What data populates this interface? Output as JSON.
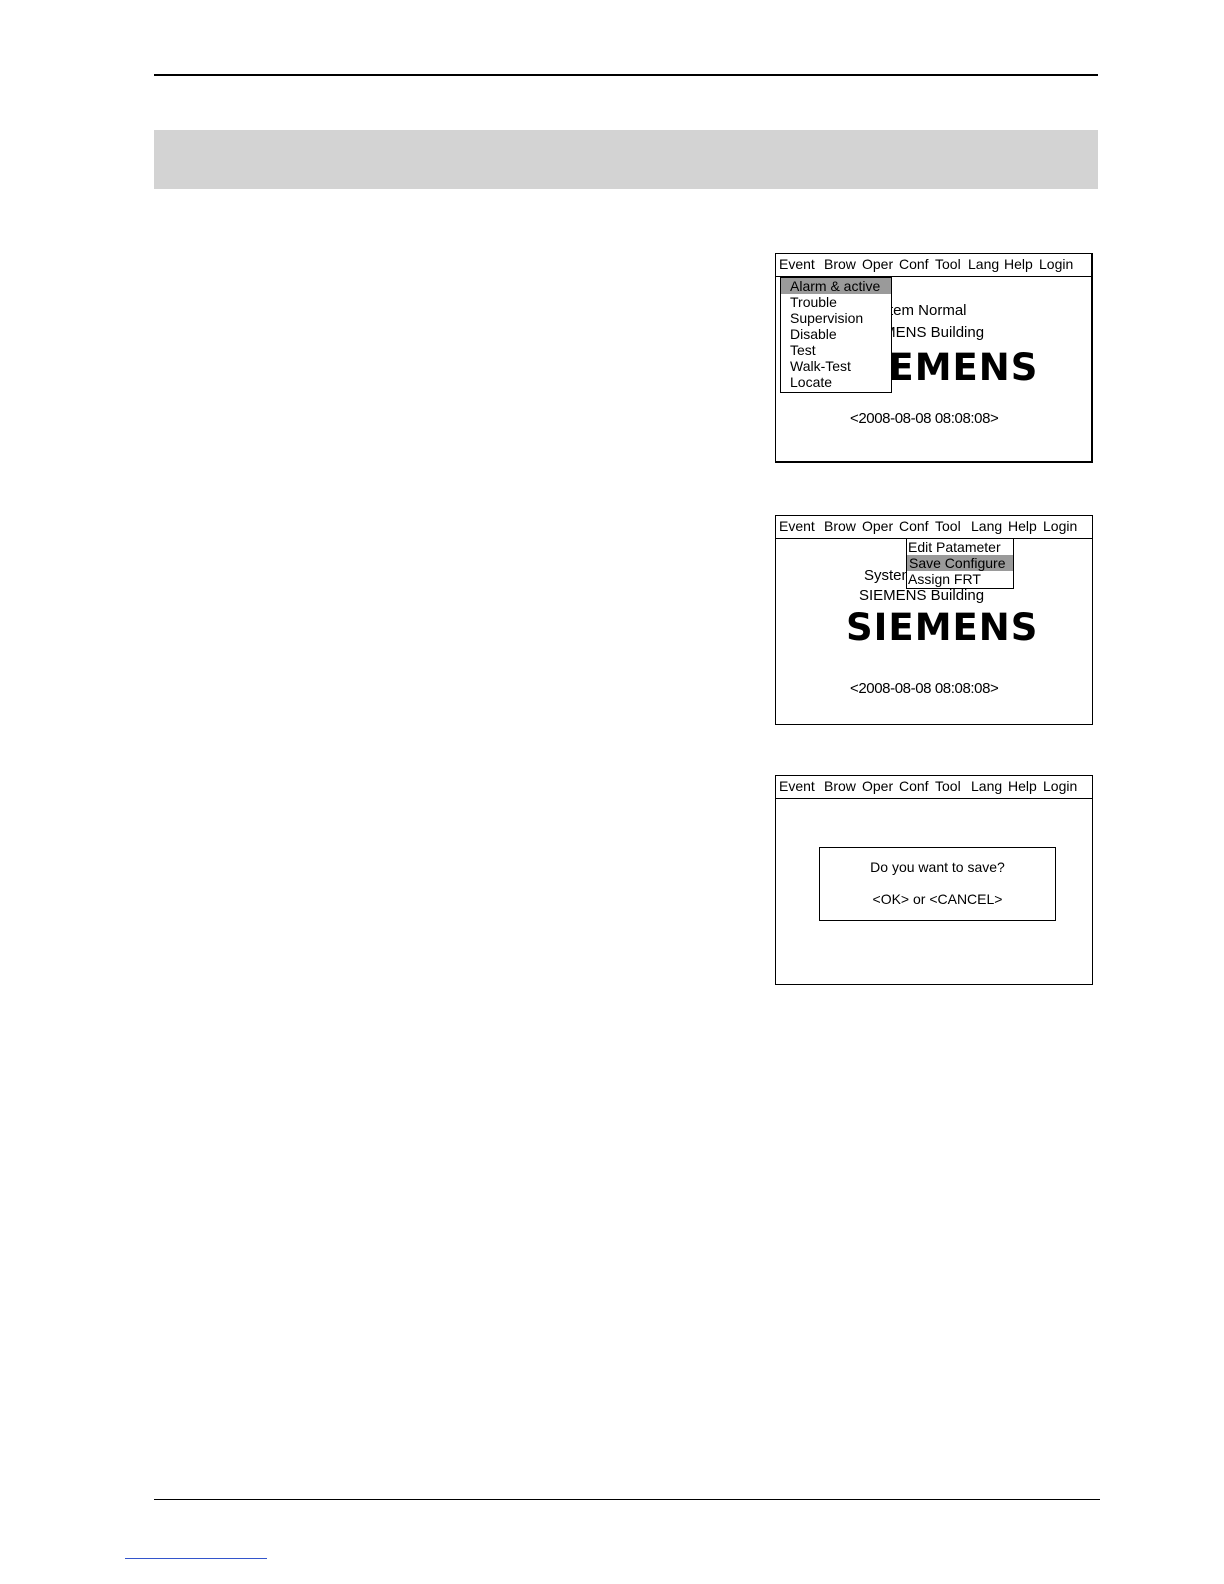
{
  "menu": [
    "Event",
    "Brow",
    "Oper",
    "Conf",
    "Tool",
    "Lang",
    "Help",
    "Login"
  ],
  "screen1": {
    "status_line": "System Normal",
    "building_line": "SIEMENS Building",
    "logo": "SIEMENS",
    "datetime": "<2008-08-08   08:08:08>",
    "event_menu": [
      "Alarm & active",
      "Trouble",
      "Supervision",
      "Disable",
      "Test",
      "Walk-Test",
      "Locate"
    ],
    "highlighted_item": "Alarm & active"
  },
  "screen2": {
    "status_line": "System Normal",
    "building_line": "SIEMENS Building",
    "logo": "SIEMENS",
    "datetime": "<2008-08-08   08:08:08>",
    "conf_menu": [
      "Edit Patameter",
      "Save Configure",
      "Assign FRT"
    ],
    "highlighted_item": "Save Configure"
  },
  "screen3": {
    "dialog_question": "Do you want to save?",
    "dialog_options": "<OK>  or  <CANCEL>"
  },
  "colors": {
    "band": "#d3d3d3",
    "highlight": "#9a9a9a",
    "link": "#3355cc"
  }
}
